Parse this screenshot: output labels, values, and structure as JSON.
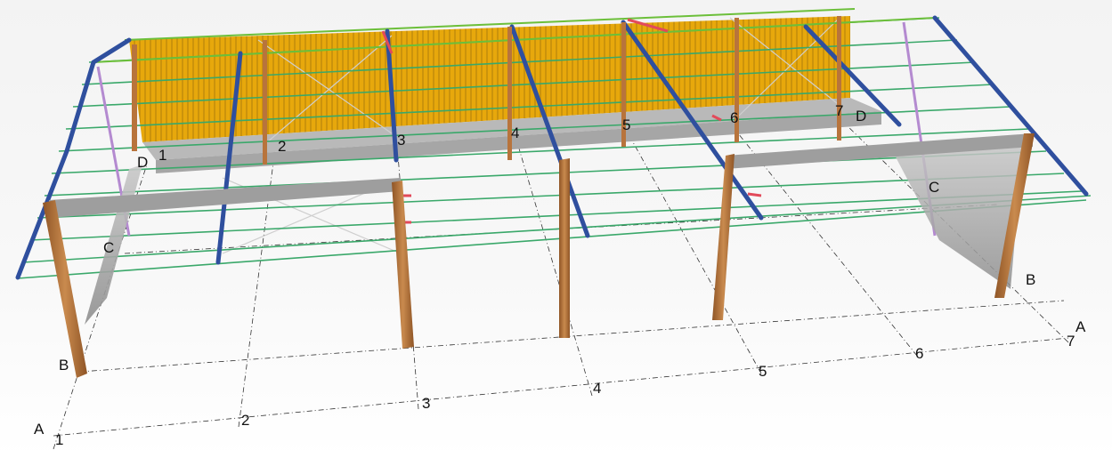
{
  "grid_labels": {
    "A_front": "A",
    "A_right": "A",
    "B_left": "B",
    "B_right": "B",
    "C_left": "C",
    "C_right": "C",
    "D_left": "D",
    "D_right": "D",
    "ground_1": "1",
    "ground_2": "2",
    "ground_3": "3",
    "ground_4": "4",
    "ground_5": "5",
    "ground_6": "6",
    "ground_7": "7",
    "back_1": "1",
    "back_2": "2",
    "back_3": "3",
    "back_4": "4",
    "back_5": "5",
    "back_6": "6",
    "back_7": "7"
  },
  "colors": {
    "cladding": "#e8a800",
    "rafter": "#2f4f9e",
    "column": "#b8743c",
    "purlin": "#3aa86a",
    "purlin_roof": "#6cbf3a",
    "wall_panel": "#9a9a9a",
    "bracing": "#b0b0b0",
    "wind_post": "#b48ad0",
    "highlight": "#e24a5a"
  },
  "icons": {
    "structure": "3d-steel-frame-model"
  }
}
